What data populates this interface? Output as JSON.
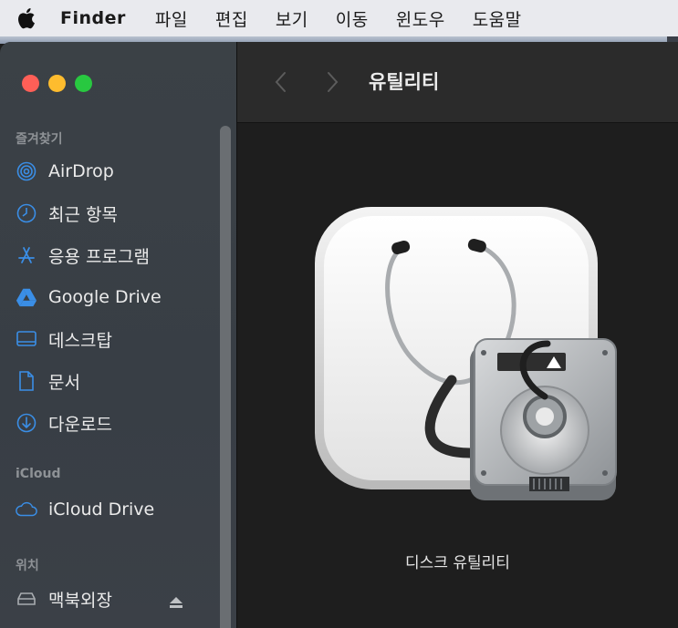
{
  "menubar": {
    "app_name": "Finder",
    "items": [
      "파일",
      "편집",
      "보기",
      "이동",
      "윈도우",
      "도움말"
    ]
  },
  "sidebar": {
    "favorites_title": "즐겨찾기",
    "favorites": [
      {
        "label": "AirDrop",
        "icon": "airdrop-icon"
      },
      {
        "label": "최근 항목",
        "icon": "clock-icon"
      },
      {
        "label": "응용 프로그램",
        "icon": "applications-icon"
      },
      {
        "label": "Google Drive",
        "icon": "google-drive-icon"
      },
      {
        "label": "데스크탑",
        "icon": "desktop-icon"
      },
      {
        "label": "문서",
        "icon": "document-icon"
      },
      {
        "label": "다운로드",
        "icon": "download-icon"
      }
    ],
    "icloud_title": "iCloud",
    "icloud": [
      {
        "label": "iCloud Drive",
        "icon": "cloud-icon"
      }
    ],
    "locations_title": "위치",
    "locations": [
      {
        "label": "맥북외장",
        "icon": "external-drive-icon"
      }
    ]
  },
  "toolbar": {
    "title": "유틸리티"
  },
  "content": {
    "item_label": "디스크 유틸리티"
  },
  "colors": {
    "accent": "#3a8ee6",
    "close": "#ff5f57",
    "minimize": "#febc2e",
    "zoom": "#28c840"
  }
}
